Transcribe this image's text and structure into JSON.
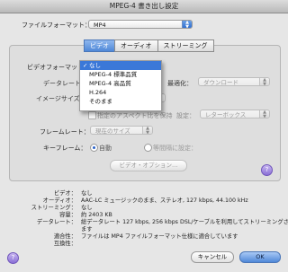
{
  "window": {
    "title": "MPEG-4 書き出し設定"
  },
  "file_format": {
    "label": "ファイルフォーマット：",
    "value": "MP4"
  },
  "tabs": [
    {
      "label": "ビデオ",
      "active": true
    },
    {
      "label": "オーディオ",
      "active": false
    },
    {
      "label": "ストリーミング",
      "active": false
    }
  ],
  "video": {
    "format_label": "ビデオフォーマット：",
    "format_value": "なし",
    "format_menu": [
      {
        "label": "なし",
        "checked": true
      },
      {
        "label": "MPEG-4 標準品質",
        "checked": false
      },
      {
        "label": "MPEG-4 高品質",
        "checked": false
      },
      {
        "label": "H.264",
        "checked": false
      },
      {
        "label": "そのまま",
        "checked": false
      }
    ],
    "datarate_label": "データレート",
    "optimize_label": "最適化：",
    "optimize_value": "ダウンロード",
    "image_size_label": "イメージサイズ",
    "preserve_aspect_label": "指定のアスペクト比を保持",
    "setting_label": "設定：",
    "setting_value": "レターボックス",
    "frame_rate_label": "フレームレート：",
    "frame_rate_value": "現在のサイズ",
    "keyframe_label": "キーフレーム：",
    "keyframe_auto": "自動",
    "keyframe_interval": "等間隔に設定：",
    "options_button": "ビデオ・オプション…"
  },
  "summary": [
    {
      "key": "ビデオ：",
      "value": "なし"
    },
    {
      "key": "オーディオ：",
      "value": "AAC-LC ミュージックのまま、ステレオ, 127 kbps, 44.100 kHz"
    },
    {
      "key": "ストリーミング：",
      "value": "なし"
    },
    {
      "key": "容量：",
      "value": "約 2403 KB"
    },
    {
      "key": "データレート：",
      "value": "総データレート 127 kbps, 256 kbps DSL/ケーブルを利用してストリーミングされ"
    },
    {
      "key": "",
      "value": "ます"
    },
    {
      "key": "適合性：",
      "value": "ファイルは MP4 ファイルフォーマット仕様に適合しています"
    },
    {
      "key": "互換性：",
      "value": ""
    }
  ],
  "buttons": {
    "cancel": "キャンセル",
    "ok": "OK",
    "help": "?"
  }
}
